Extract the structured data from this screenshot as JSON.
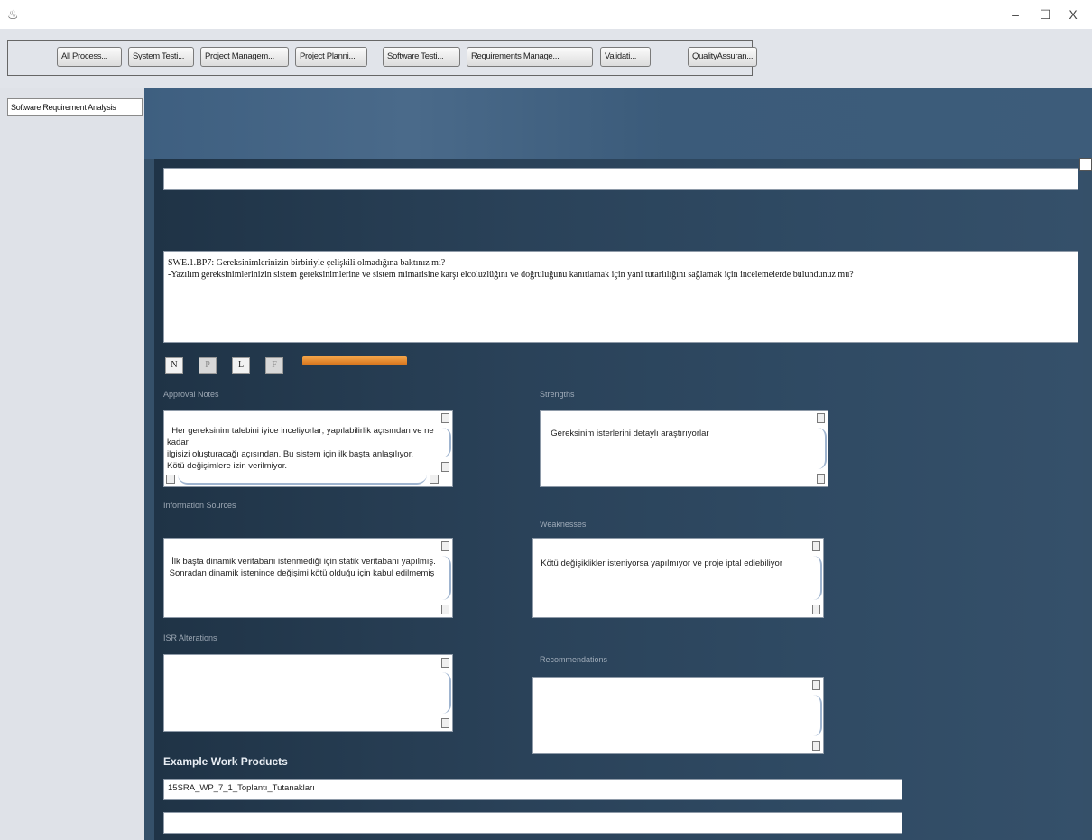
{
  "window": {
    "app_icon": "java-cup-icon",
    "minimize": "–",
    "maximize": "☐",
    "close": "X"
  },
  "process_tabs": [
    "All Process...",
    "System Testi...",
    "Project Managem...",
    "Project Planni...",
    "Software Testi...",
    "Requirements Manage...",
    "Validati...",
    "QualityAssuran..."
  ],
  "side_tab": "Software Requirement Analysis",
  "question": {
    "line1": "SWE.1.BP7:  Gereksinimlerinizin birbiriyle çelişkili olmadığına baktınız mı?",
    "line2": "-Yazılım gereksinimlerinizin sistem gereksinimlerine ve sistem mimarisine karşı elcoluzlüğını ve doğruluğunu kanıtlamak için yani tutarlılığını sağlamak için incelemelerde bulundunuz mu?"
  },
  "rating": {
    "buttons": [
      "N",
      "P",
      "L",
      "F"
    ],
    "accent": "#e07d22"
  },
  "sections": {
    "approval_notes": {
      "label": "Approval Notes",
      "text": "Her gereksinim talebini iyice inceliyorlar; yapılabilirlik açısından ve ne kadar\nilgisizi oluşturacağı açısından. Bu sistem için ilk başta anlaşılıyor.\nKötü değişimlere izin verilmiyor."
    },
    "strengths": {
      "label": "Strengths",
      "text": "Gereksinim isterlerini detaylı araştırıyorlar"
    },
    "information_sources": {
      "label": "Information Sources",
      "text": "İlk başta dinamik veritabanı istenmediği için statik veritabanı yapılmış.\n Sonradan dinamik istenince değişimi kötü olduğu için kabul edilmemiş"
    },
    "weaknesses": {
      "label": "Weaknesses",
      "text": "Kötü değişiklikler isteniyorsa yapılmıyor ve proje iptal ediebiliyor"
    },
    "isr_alterations": {
      "label": "ISR Alterations",
      "text": ""
    },
    "recommendations": {
      "label": "Recommendations",
      "text": ""
    }
  },
  "example_work_products": {
    "title": "Example Work Products",
    "items": [
      "15SRA_WP_7_1_Toplantı_Tutanakları",
      ""
    ]
  }
}
